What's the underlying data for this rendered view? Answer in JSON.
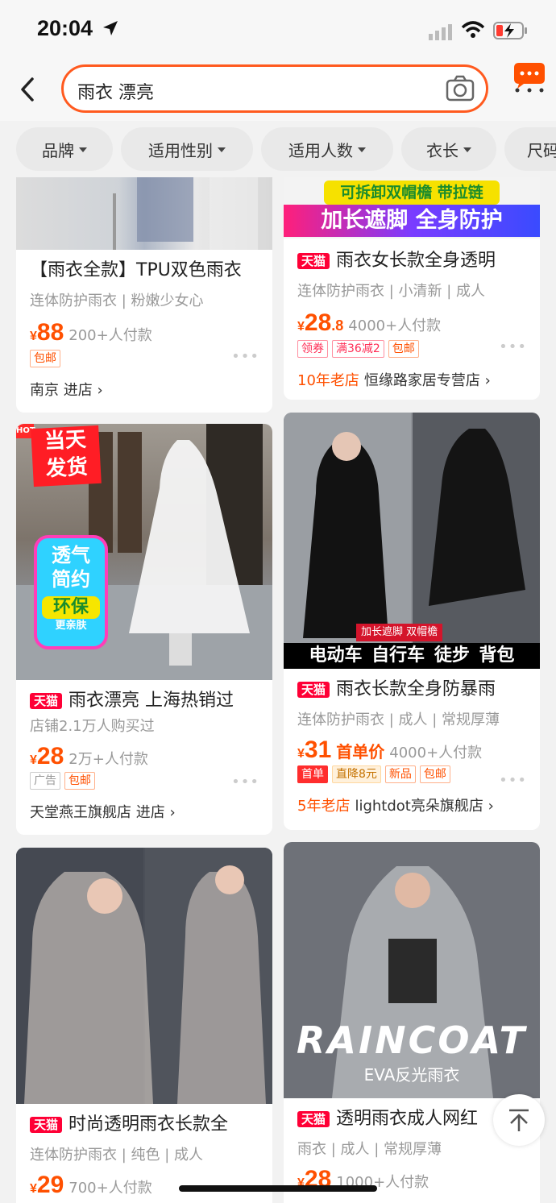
{
  "status_bar": {
    "time": "20:04"
  },
  "search": {
    "query": "雨衣 漂亮"
  },
  "filters": [
    {
      "label": "品牌"
    },
    {
      "label": "适用性别"
    },
    {
      "label": "适用人数"
    },
    {
      "label": "衣长"
    },
    {
      "label": "尺码"
    }
  ],
  "products": [
    {
      "image_text": [],
      "title": "【雨衣全款】TPU双色雨衣",
      "tmall": false,
      "attributes": "连体防护雨衣 | 粉嫩少女心",
      "price": {
        "currency": "¥",
        "integer": "88",
        "decimal": ""
      },
      "sold": "200+人付款",
      "tags": [
        "包邮"
      ],
      "shop": {
        "age": "",
        "name": "南京 进店 ›"
      }
    },
    {
      "image_text": [
        "可拆卸双帽檐 带拉链",
        "加长遮脚 全身防护"
      ],
      "title": "雨衣女长款全身透明",
      "tmall": true,
      "tmall_label": "天猫",
      "attributes": "连体防护雨衣 | 小清新 | 成人",
      "price": {
        "currency": "¥",
        "integer": "28",
        "decimal": ".8"
      },
      "sold": "4000+人付款",
      "tags": [
        "领券",
        "满36减2",
        "包邮"
      ],
      "shop": {
        "age": "10年老店",
        "name": "恒缘路家居专营店 ›"
      }
    },
    {
      "image_text": [
        "HOT",
        "当天",
        "发货",
        "透气",
        "简约",
        "环保",
        "更亲肤"
      ],
      "title": "雨衣漂亮 上海热销过",
      "tmall": true,
      "tmall_label": "天猫",
      "attributes": "店铺2.1万人购买过",
      "price": {
        "currency": "¥",
        "integer": "28",
        "decimal": ""
      },
      "sold": "2万+人付款",
      "tags": [
        "广告",
        "包邮"
      ],
      "shop": {
        "age": "",
        "name": "天堂燕王旗舰店 进店 ›"
      }
    },
    {
      "image_text": [
        "加长遮脚 双帽檐",
        "电动车 自行车 徒步 背包"
      ],
      "title": "雨衣长款全身防暴雨",
      "tmall": true,
      "tmall_label": "天猫",
      "attributes": "连体防护雨衣 | 成人 | 常规厚薄",
      "price": {
        "currency": "¥",
        "integer": "31",
        "decimal": ""
      },
      "price_note": "首单价",
      "sold": "4000+人付款",
      "tags": [
        "首单",
        "直降8元",
        "新品",
        "包邮"
      ],
      "shop": {
        "age": "5年老店",
        "name": "lightdot亮朵旗舰店 ›"
      }
    },
    {
      "image_text": [],
      "title": "时尚透明雨衣长款全",
      "tmall": true,
      "tmall_label": "天猫",
      "attributes": "连体防护雨衣 | 纯色 | 成人",
      "price": {
        "currency": "¥",
        "integer": "29",
        "decimal": ""
      },
      "sold": "700+人付款",
      "tags": [],
      "shop": {
        "age": "",
        "name": ""
      }
    },
    {
      "image_text": [
        "RAINCOAT",
        "EVA反光雨衣"
      ],
      "title": "透明雨衣成人网红",
      "tmall": true,
      "tmall_label": "天猫",
      "attributes": "雨衣 | 成人 | 常规厚薄",
      "price": {
        "currency": "¥",
        "integer": "28",
        "decimal": ""
      },
      "sold": "1000+人付款",
      "tags": [],
      "shop": {
        "age": "",
        "name": ""
      }
    }
  ],
  "colors": {
    "accent": "#ff5000",
    "tmall": "#ff0036",
    "search_border": "#ff5a1f"
  }
}
